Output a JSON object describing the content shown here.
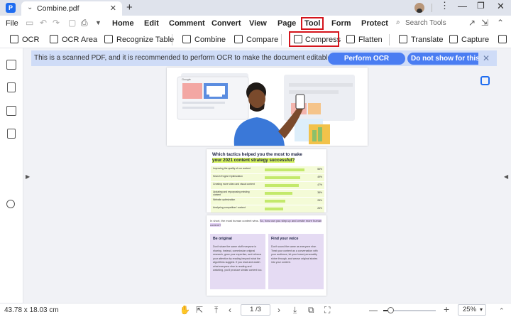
{
  "titlebar": {
    "tab_title": "Combine.pdf",
    "icons": [
      "app-logo-icon",
      "chevron-down-icon",
      "close-icon",
      "plus-icon",
      "avatar",
      "minimize-icon",
      "maximize-icon",
      "close-icon"
    ]
  },
  "menubar": {
    "file": "File",
    "items": [
      "Home",
      "Edit",
      "Comment",
      "Convert",
      "View",
      "Page",
      "Tool",
      "Form",
      "Protect"
    ],
    "highlighted": "Tool",
    "search_placeholder": "Search Tools",
    "icons": [
      "save-icon",
      "undo-icon",
      "redo-icon",
      "print-icon",
      "dropdown-icon",
      "share-icon",
      "collapse-icon"
    ]
  },
  "toolbar": {
    "items": [
      "OCR",
      "OCR Area",
      "Recognize Table",
      "Combine",
      "Compare",
      "Compress",
      "Flatten",
      "Translate",
      "Capture"
    ],
    "highlighted": "Compress"
  },
  "notice": {
    "text": "This is a scanned PDF, and it is recommended to perform OCR to make the document editable and searchable.",
    "perform_ocr": "Perform OCR",
    "do_not_show": "Do not show for this file"
  },
  "sidebar": {
    "icons": [
      "thumbnails-icon",
      "bookmark-icon",
      "comment-icon",
      "attachment-icon",
      "search-icon"
    ]
  },
  "page1": {
    "google_label": "Google"
  },
  "page2": {
    "title_line1": "Which tactics helped you the most to make",
    "title_line2": "your 2021 content strategy successful?",
    "rows": [
      {
        "label": "Improving the quality of our content",
        "pct": "55%",
        "value": 55
      },
      {
        "label": "Search Engine Optimization",
        "pct": "49%",
        "value": 49
      },
      {
        "label": "Creating more video and visual content",
        "pct": "47%",
        "value": 47
      },
      {
        "label": "Updating and repurposing existing content",
        "pct": "38%",
        "value": 38
      },
      {
        "label": "Website optimization",
        "pct": "28%",
        "value": 28
      },
      {
        "label": "Analyzing competitors' content",
        "pct": "26%",
        "value": 26
      }
    ]
  },
  "page3": {
    "intro_plain": "In short, the most human content wins.",
    "intro_highlight": "So, how can you step up and create more human content?",
    "card1_title": "Be original",
    "card1_body": "Don't share the same stuff everyone is sharing. Instead, commission original research, grow your expertise, and refocus your attention by reading beyond what the algorithms suggest. If you read and watch what everyone else is reading and watching, you'll produce similar content too.",
    "card2_title": "Find your voice",
    "card2_body": "Don't sound the same as everyone else. Treat your content as a conversation with your audience, let your brand personality shine through, and weave original stories into your content."
  },
  "statusbar": {
    "dimensions": "43.78 x 18.03 cm",
    "page": "1 /3",
    "zoom": "25%",
    "zoom_level": 0.14
  }
}
